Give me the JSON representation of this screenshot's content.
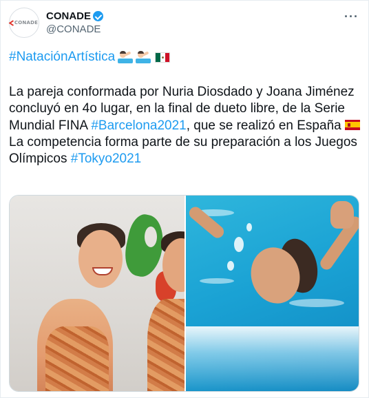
{
  "header": {
    "avatar_text": "CONADE",
    "display_name": "CONADE",
    "handle": "@CONADE",
    "more_label": "···",
    "verified": true
  },
  "tweet": {
    "hashtag_top": "#NataciónArtística",
    "paragraph_1_part_1": "La pareja conformada por Nuria Diosdado y Joana Jiménez concluyó en 4o lugar, en la final de dueto libre, de la Serie Mundial FINA ",
    "paragraph_1_hashtag": "#Barcelona2021",
    "paragraph_1_part_2": ", que se realizó en España ",
    "paragraph_2_part_1": "La competencia forma parte de su preparación a los Juegos Olímpicos ",
    "paragraph_2_hashtag": "#Tokyo2021"
  },
  "icons": {
    "swimmer_emoji": "person-swimming-icon",
    "mexico_flag": "mexico-flag-icon",
    "spain_flag": "spain-flag-icon",
    "verified_badge": "verified-badge-icon"
  },
  "colors": {
    "link": "#1d9bf0",
    "text": "#0f1419",
    "secondary": "#536471",
    "verified": "#1d9bf0"
  },
  "media": {
    "photos": [
      {
        "description_name": "swimmers-podium-photo"
      },
      {
        "description_name": "swimmer-in-pool-photo"
      }
    ]
  }
}
